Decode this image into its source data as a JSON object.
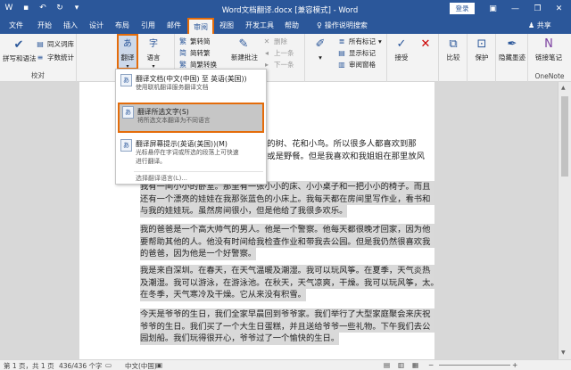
{
  "window": {
    "title": "Word文档翻译.docx [兼容模式] - Word",
    "login": "登录"
  },
  "tabs": [
    "文件",
    "开始",
    "插入",
    "设计",
    "布局",
    "引用",
    "邮件",
    "审阅",
    "视图",
    "开发工具",
    "帮助"
  ],
  "active_tab": "审阅",
  "search_hint": "操作说明搜索",
  "share": "共享",
  "ribbon": {
    "proofing": {
      "spelling": "拼写和语法",
      "thesaurus": "同义词库",
      "wordcount": "字数统计",
      "label": "校对"
    },
    "translate": {
      "label": "翻译"
    },
    "language": {
      "label": "语言"
    },
    "chinese": {
      "simp_to_trad": "繁转简",
      "trad_to_simp": "简转繁",
      "convert": "简繁转换"
    },
    "comments": {
      "new_comment": "新建批注",
      "delete": "删除",
      "prev": "上一条",
      "next": "下一条"
    },
    "tracking": {
      "markup": "所有标记",
      "show_markup": "显示标记",
      "pane": "审阅窗格"
    },
    "changes": {
      "accept": "接受"
    },
    "compare": {
      "compare": "比较"
    },
    "protect": {
      "protect": "保护"
    },
    "ink": {
      "hide_ink": "隐藏墨迹"
    },
    "onenote": {
      "linked_notes": "链接笔记",
      "label": "OneNote"
    }
  },
  "dropdown": {
    "item1_title": "翻译文档(中文(中国) 至 英语(美国))",
    "item1_desc": "使用联机翻译服务翻译文档",
    "item2_title": "翻译所选文字(S)",
    "item2_desc": "将所选文本翻译为不同语言",
    "item3_title": "翻译屏幕提示(英语(美国))(M)",
    "item3_desc1": "光标悬停在字词或所选的段落上可快速",
    "item3_desc2": "进行翻译。",
    "footer": "选择翻译语言(L)..."
  },
  "document": {
    "p1_lines": [
      "丽的树、花和小鸟。所以很多人都喜欢到那",
      "步或是野餐。但是我喜欢和我姐姐在那里放风"
    ],
    "p2_lines": [
      "我有一间小小的卧室。那里有一张小小的床、小小桌子和一把小小的椅子。而且",
      "还有一个漂亮的娃娃在我那张蓝色的小床上。我每天都在房间里写作业，看书和",
      "与我的娃娃玩。虽然房间很小，但是他给了我很多欢乐。"
    ],
    "p3_lines": [
      "我的爸爸是一个高大帅气的男人。他是一个警察。他每天都很晚才回家，因为他",
      "要帮助其他的人。他没有时间给我检查作业和带我去公园。但是我仍然很喜欢我",
      "的爸爸，因为他是一个好警察。"
    ],
    "p4_lines": [
      "我是来自深圳。在春天，在天气温暖及潮湿。我可以玩风筝。在夏季，天气炎热",
      "及潮湿。我可以游泳，在游泳池。在秋天，天气凉爽，干燥。我可以玩风筝，太。",
      "在冬季，天气寒冷及干燥。它从来没有积雪。"
    ],
    "p5_lines": [
      "今天是爷爷的生日，我们全家早晨回到爷爷家。我们举行了大型家庭聚会来庆祝",
      "爷爷的生日。我们买了一个大生日蛋糕，并且送给爷爷一些礼物。下午我们去公",
      "园划船。我们玩得很开心，爷爷过了一个愉快的生日。"
    ]
  },
  "status": {
    "page": "第 1 页，共 1 页",
    "words": "436/436 个字",
    "lang": "中文(中国)"
  },
  "colors": {
    "brand": "#2b579a",
    "highlight_border": "#e46c0a"
  }
}
